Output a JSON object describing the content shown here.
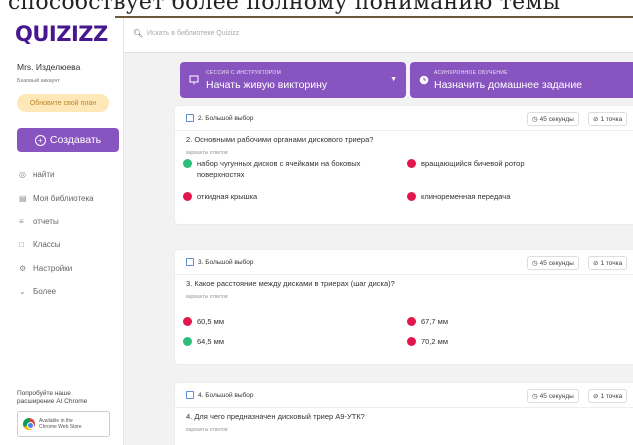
{
  "overlay": {
    "text": "способствует более полному пониманию темы"
  },
  "sidebar": {
    "logo": "QUIZIZZ",
    "user_name": "Mrs. Изделюева",
    "account_type": "Базовый аккаунт",
    "upgrade_label": "Обновите свой план",
    "create_label": "Создавать",
    "nav": [
      {
        "label": "найти",
        "icon": "compass-icon"
      },
      {
        "label": "Моя библиотека",
        "icon": "library-icon"
      },
      {
        "label": "отчеты",
        "icon": "reports-icon"
      },
      {
        "label": "Классы",
        "icon": "classes-icon"
      },
      {
        "label": "Настройки",
        "icon": "gear-icon"
      },
      {
        "label": "Более",
        "icon": "chevron-down-icon"
      }
    ],
    "promo_text": "Попробуйте наше расширение AI Chrome",
    "store_line1": "Available in the",
    "store_line2": "Chrome Web Store"
  },
  "search": {
    "placeholder": "Искать в библиотеке Quizizz"
  },
  "actions": {
    "live": {
      "sub": "СЕССИЯ С ИНСТРУКТОРОМ",
      "label": "Начать живую викторину"
    },
    "homework": {
      "sub": "АСИНХРОННОЕ ОБУЧЕНИЕ",
      "label": "Назначить домашнее задание"
    }
  },
  "questions": [
    {
      "header": "2. Большой выбор",
      "time": "45 секунды",
      "points": "1 точка",
      "text": "2. Основными рабочими органами дискового триера?",
      "answers_label": "варианты ответов",
      "answers": [
        {
          "text": "набор чугунных дисков с ячейками на боковых поверхностях",
          "correct": true
        },
        {
          "text": "вращающийся бичевой ротор",
          "correct": false
        },
        {
          "text": "откидная крышка",
          "correct": false
        },
        {
          "text": "клиноременная передача",
          "correct": false
        }
      ]
    },
    {
      "header": "3. Большой выбор",
      "time": "45 секунды",
      "points": "1 точка",
      "text": "3. Какое расстояние между дисками в триерах  (шаг диска)?",
      "answers_label": "варианты ответов",
      "answers": [
        {
          "text": "60,5 мм",
          "correct": false
        },
        {
          "text": "67,7 мм",
          "correct": false
        },
        {
          "text": "64,5 мм",
          "correct": true
        },
        {
          "text": "70,2 мм",
          "correct": false
        }
      ]
    },
    {
      "header": "4. Большой выбор",
      "time": "45 секунды",
      "points": "1 точка",
      "text": "4. Для чего предназначен дисковый триер А9-УТК?",
      "answers_label": "варианты ответов"
    }
  ],
  "colors": {
    "brand": "#8854c0",
    "logo": "#46178f",
    "correct": "#2bbf7a",
    "incorrect": "#e2164d"
  }
}
